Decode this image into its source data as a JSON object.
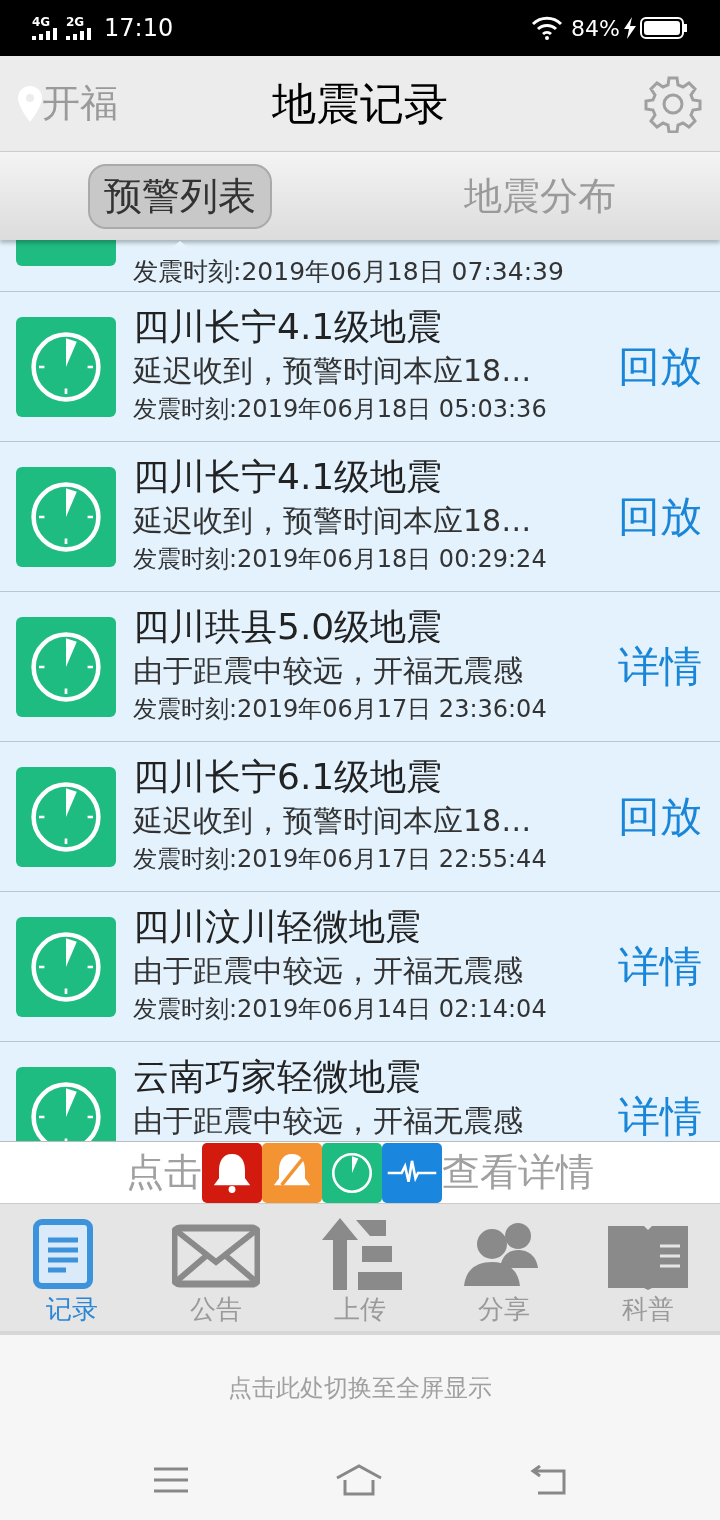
{
  "status_bar": {
    "network_1": "4G",
    "network_2": "2G",
    "time": "17:10",
    "battery": "84%"
  },
  "header": {
    "location": "开福",
    "title": "地震记录"
  },
  "tabs": [
    {
      "label": "预警列表",
      "selected": true
    },
    {
      "label": "地震分布",
      "selected": false
    }
  ],
  "records": [
    {
      "time": "发震时刻:2019年06月18日 07:34:39"
    },
    {
      "title": "四川长宁4.1级地震",
      "subtitle": "延迟收到，预警时间本应18…",
      "time": "发震时刻:2019年06月18日 05:03:36",
      "action": "回放"
    },
    {
      "title": "四川长宁4.1级地震",
      "subtitle": "延迟收到，预警时间本应18…",
      "time": "发震时刻:2019年06月18日 00:29:24",
      "action": "回放"
    },
    {
      "title": "四川珙县5.0级地震",
      "subtitle": "由于距震中较远，开福无震感",
      "time": "发震时刻:2019年06月17日 23:36:04",
      "action": "详情"
    },
    {
      "title": "四川长宁6.1级地震",
      "subtitle": "延迟收到，预警时间本应18…",
      "time": "发震时刻:2019年06月17日 22:55:44",
      "action": "回放"
    },
    {
      "title": "四川汶川轻微地震",
      "subtitle": "由于距震中较远，开福无震感",
      "time": "发震时刻:2019年06月14日 02:14:04",
      "action": "详情"
    },
    {
      "title": "云南巧家轻微地震",
      "subtitle": "由于距震中较远，开福无震感",
      "action": "详情"
    }
  ],
  "legend": {
    "prefix": "点击",
    "suffix": "查看详情",
    "icons": [
      {
        "kind": "bell",
        "color": "#d21a0e"
      },
      {
        "kind": "bell-muted",
        "color": "#f39331"
      },
      {
        "kind": "clock",
        "color": "#1fbc82"
      },
      {
        "kind": "wave",
        "color": "#1a86de"
      }
    ]
  },
  "bottom_tabs": [
    {
      "label": "记录",
      "kind": "clipboard",
      "selected": true
    },
    {
      "label": "公告",
      "kind": "mail",
      "selected": false
    },
    {
      "label": "上传",
      "kind": "upload",
      "selected": false
    },
    {
      "label": "分享",
      "kind": "people",
      "selected": false
    },
    {
      "label": "科普",
      "kind": "book",
      "selected": false
    }
  ],
  "fullscreen_hint": "点击此处切换至全屏显示"
}
